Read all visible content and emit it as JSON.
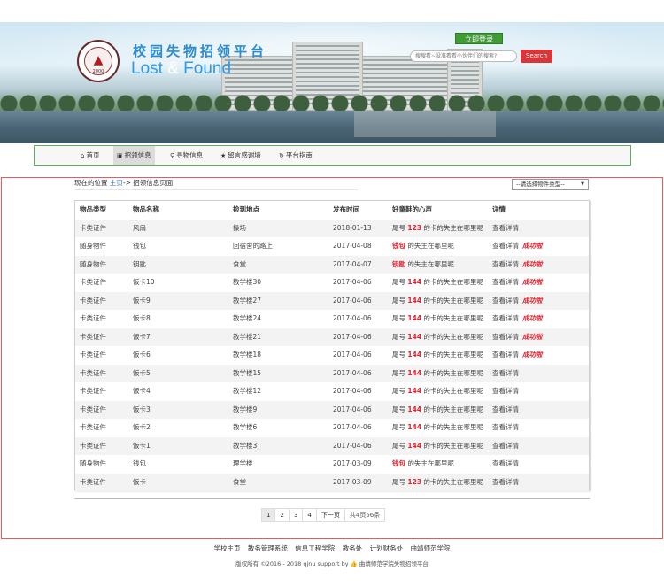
{
  "header": {
    "logo_year": "2000",
    "site_title": "校园失物招领平台",
    "site_subtitle_a": "Lost",
    "site_subtitle_amp": " & ",
    "site_subtitle_b": "Found",
    "login_label": "立即登录",
    "search_placeholder": "搜搜看~没准看看小伙伴们的搜索?",
    "search_label": "Search"
  },
  "nav": {
    "items": [
      {
        "icon": "home-icon",
        "glyph": "⌂",
        "label": "首页"
      },
      {
        "icon": "image-icon",
        "glyph": "▣",
        "label": "招领信息"
      },
      {
        "icon": "search-icon",
        "glyph": "⚲",
        "label": "寻物信息"
      },
      {
        "icon": "star-icon",
        "glyph": "★",
        "label": "留言感谢墙"
      },
      {
        "icon": "share-icon",
        "glyph": "↻",
        "label": "平台指南"
      }
    ]
  },
  "breadcrumb": {
    "prefix": "现在的位置",
    "home": "主页",
    "sep": "-> ",
    "current": "招领信息页面"
  },
  "filter": {
    "select_value": "--请选择物件类型--"
  },
  "table": {
    "headers": [
      "物品类型",
      "物品名称",
      "捡到地点",
      "发布时间",
      "好童鞋的心声",
      "详情"
    ],
    "rows": [
      {
        "type": "卡类证件",
        "name": "风扇",
        "place": "操场",
        "date": "2018-01-13",
        "msg_a": "尾号 ",
        "msg_hl": "123",
        "msg_b": " 的卡的失主在哪里呢",
        "detail": "查看详情",
        "success": ""
      },
      {
        "type": "随身物件",
        "name": "钱包",
        "place": "回宿舍的路上",
        "date": "2017-04-08",
        "msg_a": "",
        "msg_hl": "钱包",
        "msg_b": " 的失主在哪里呢",
        "detail": "查看详情",
        "success": "成功啦"
      },
      {
        "type": "随身物件",
        "name": "钥匙",
        "place": "食堂",
        "date": "2017-04-07",
        "msg_a": "",
        "msg_hl": "钥匙",
        "msg_b": " 的失主在哪里呢",
        "detail": "查看详情",
        "success": "成功啦"
      },
      {
        "type": "卡类证件",
        "name": "饭卡10",
        "place": "教学楼30",
        "date": "2017-04-06",
        "msg_a": "尾号 ",
        "msg_hl": "144",
        "msg_b": " 的卡的失主在哪里呢",
        "detail": "查看详情",
        "success": "成功啦"
      },
      {
        "type": "卡类证件",
        "name": "饭卡9",
        "place": "教学楼27",
        "date": "2017-04-06",
        "msg_a": "尾号 ",
        "msg_hl": "144",
        "msg_b": " 的卡的失主在哪里呢",
        "detail": "查看详情",
        "success": "成功啦"
      },
      {
        "type": "卡类证件",
        "name": "饭卡8",
        "place": "教学楼24",
        "date": "2017-04-06",
        "msg_a": "尾号 ",
        "msg_hl": "144",
        "msg_b": " 的卡的失主在哪里呢",
        "detail": "查看详情",
        "success": "成功啦"
      },
      {
        "type": "卡类证件",
        "name": "饭卡7",
        "place": "教学楼21",
        "date": "2017-04-06",
        "msg_a": "尾号 ",
        "msg_hl": "144",
        "msg_b": " 的卡的失主在哪里呢",
        "detail": "查看详情",
        "success": "成功啦"
      },
      {
        "type": "卡类证件",
        "name": "饭卡6",
        "place": "教学楼18",
        "date": "2017-04-06",
        "msg_a": "尾号 ",
        "msg_hl": "144",
        "msg_b": " 的卡的失主在哪里呢",
        "detail": "查看详情",
        "success": "成功啦"
      },
      {
        "type": "卡类证件",
        "name": "饭卡5",
        "place": "教学楼15",
        "date": "2017-04-06",
        "msg_a": "尾号 ",
        "msg_hl": "144",
        "msg_b": " 的卡的失主在哪里呢",
        "detail": "查看详情",
        "success": ""
      },
      {
        "type": "卡类证件",
        "name": "饭卡4",
        "place": "教学楼12",
        "date": "2017-04-06",
        "msg_a": "尾号 ",
        "msg_hl": "144",
        "msg_b": " 的卡的失主在哪里呢",
        "detail": "查看详情",
        "success": ""
      },
      {
        "type": "卡类证件",
        "name": "饭卡3",
        "place": "教学楼9",
        "date": "2017-04-06",
        "msg_a": "尾号 ",
        "msg_hl": "144",
        "msg_b": " 的卡的失主在哪里呢",
        "detail": "查看详情",
        "success": ""
      },
      {
        "type": "卡类证件",
        "name": "饭卡2",
        "place": "教学楼6",
        "date": "2017-04-06",
        "msg_a": "尾号 ",
        "msg_hl": "144",
        "msg_b": " 的卡的失主在哪里呢",
        "detail": "查看详情",
        "success": ""
      },
      {
        "type": "卡类证件",
        "name": "饭卡1",
        "place": "教学楼3",
        "date": "2017-04-06",
        "msg_a": "尾号 ",
        "msg_hl": "144",
        "msg_b": " 的卡的失主在哪里呢",
        "detail": "查看详情",
        "success": ""
      },
      {
        "type": "随身物件",
        "name": "钱包",
        "place": "理学楼",
        "date": "2017-03-09",
        "msg_a": "",
        "msg_hl": "钱包",
        "msg_b": " 的失主在哪里呢",
        "detail": "查看详情",
        "success": ""
      },
      {
        "type": "卡类证件",
        "name": "饭卡",
        "place": "食堂",
        "date": "2017-03-09",
        "msg_a": "尾号 ",
        "msg_hl": "123",
        "msg_b": " 的卡的失主在哪里呢",
        "detail": "查看详情",
        "success": ""
      }
    ]
  },
  "pagination": {
    "pages": [
      "1",
      "2",
      "3",
      "4"
    ],
    "next": "下一页",
    "info": "共4页56条"
  },
  "footer": {
    "links": [
      "学校主页",
      "教务管理系统",
      "信息工程学院",
      "教务处",
      "计划财务处",
      "曲靖师范学院"
    ],
    "copyright": "版权所有 ©2016 - 2018 qjnu support by",
    "thumb_glyph": "👍",
    "thumb_icon": "thumbs-up-icon",
    "credit": "曲靖师范学院失物招领平台"
  }
}
